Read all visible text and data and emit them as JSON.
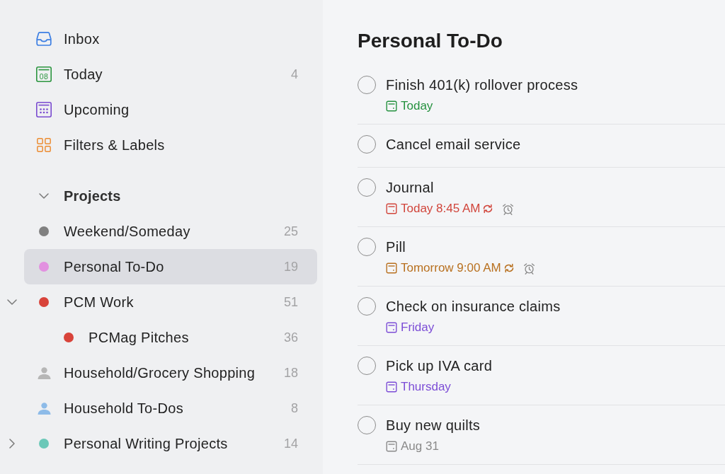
{
  "sidebar": {
    "nav_items": [
      {
        "kind": "inbox",
        "label": "Inbox",
        "selected": false
      },
      {
        "kind": "today",
        "label": "Today",
        "icon_text": "08",
        "count": "4",
        "selected": false
      },
      {
        "kind": "upcoming",
        "label": "Upcoming",
        "selected": false
      },
      {
        "kind": "filters",
        "label": "Filters & Labels",
        "selected": false
      }
    ],
    "projects": {
      "title": "Projects",
      "expanded": true,
      "items": [
        {
          "label": "Weekend/Someday",
          "count": "25",
          "kind": "dot",
          "color": "#808080",
          "selected": false
        },
        {
          "label": "Personal To-Do",
          "count": "19",
          "kind": "dot",
          "color": "#e291e0",
          "selected": true
        },
        {
          "label": "PCM Work",
          "count": "51",
          "kind": "dot",
          "color": "#d8433a",
          "selected": false,
          "expanded": true,
          "children": [
            {
              "label": "PCMag Pitches",
              "count": "36",
              "kind": "dot",
              "color": "#d8433a",
              "selected": false
            }
          ]
        },
        {
          "label": "Household/Grocery Shopping",
          "count": "18",
          "kind": "person",
          "color": "#b6b6b6",
          "selected": false
        },
        {
          "label": "Household To-Dos",
          "count": "8",
          "kind": "person",
          "color": "#8dbbe8",
          "selected": false
        },
        {
          "label": "Personal Writing Projects",
          "count": "14",
          "kind": "dot",
          "color": "#6bc8b8",
          "selected": false,
          "expanded": false
        }
      ]
    }
  },
  "main": {
    "title": "Personal To-Do",
    "tasks": [
      {
        "title": "Finish 401(k) rollover process",
        "checked": false,
        "due": {
          "text": "Today",
          "color": "#25913f"
        }
      },
      {
        "title": "Cancel email service",
        "checked": false
      },
      {
        "title": "Journal",
        "checked": false,
        "due": {
          "text": "Today 8:45 AM",
          "color": "#d1453b",
          "recurring": true,
          "reminder": true
        }
      },
      {
        "title": "Pill",
        "checked": false,
        "due": {
          "text": "Tomorrow 9:00 AM",
          "color": "#b8701f",
          "recurring": true,
          "reminder": true
        }
      },
      {
        "title": "Check on insurance claims",
        "checked": false,
        "due": {
          "text": "Friday",
          "color": "#7c4dd6"
        }
      },
      {
        "title": "Pick up IVA card",
        "checked": false,
        "due": {
          "text": "Thursday",
          "color": "#7c4dd6"
        }
      },
      {
        "title": "Buy new quilts",
        "checked": false,
        "due": {
          "text": "Aug 31",
          "color": "#8a8a8a"
        }
      }
    ]
  }
}
